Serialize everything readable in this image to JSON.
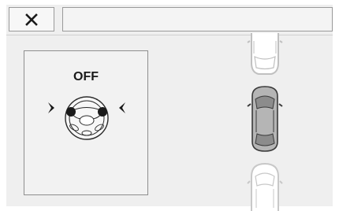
{
  "header": {
    "close_icon": "close-icon",
    "title": ""
  },
  "assist_panel": {
    "status": "OFF",
    "wheel_icon": "steering-wheel-icon",
    "arrows_icon": "inward-arrows-icon"
  },
  "parking_view": {
    "vehicles": [
      "front-parked-car",
      "own-car",
      "rear-parked-car"
    ]
  },
  "colors": {
    "background": "#efefef",
    "border": "#9a9a9a",
    "own_car": "#b5b5b5",
    "parked_car_outline": "#c8c8c8"
  }
}
